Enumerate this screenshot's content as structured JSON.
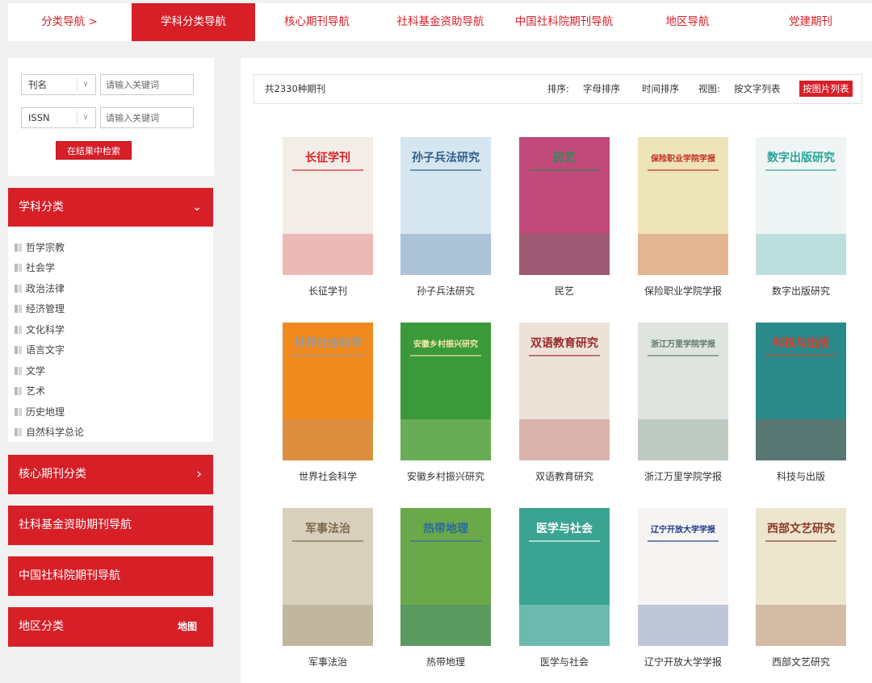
{
  "topnav": {
    "items": [
      {
        "label": "分类导航 >"
      },
      {
        "label": "学科分类导航"
      },
      {
        "label": "核心期刊导航"
      },
      {
        "label": "社科基金资助导航"
      },
      {
        "label": "中国社科院期刊导航"
      },
      {
        "label": "地区导航"
      },
      {
        "label": "党建期刊"
      }
    ],
    "active_index": 1
  },
  "search": {
    "field1": {
      "selected": "刊名",
      "placeholder": "请输入关键词"
    },
    "field2": {
      "selected": "ISSN",
      "placeholder": "请输入关键词"
    },
    "button_label": "在结果中检索"
  },
  "sidebar": {
    "subject": {
      "title": "学科分类",
      "categories": [
        "哲学宗教",
        "社会学",
        "政治法律",
        "经济管理",
        "文化科学",
        "语言文字",
        "文学",
        "艺术",
        "历史地理",
        "自然科学总论"
      ]
    },
    "core": {
      "title": "核心期刊分类"
    },
    "fund": {
      "title": "社科基金资助期刊导航"
    },
    "cass": {
      "title": "中国社科院期刊导航"
    },
    "region": {
      "title": "地区分类",
      "map_label": "地图"
    }
  },
  "toolbar": {
    "count_text": "共2330种期刊",
    "sort_label": "排序:",
    "sort_letter": "字母排序",
    "sort_time": "时间排序",
    "view_label": "视图:",
    "view_text": "按文字列表",
    "view_picture": "按图片列表"
  },
  "journals": [
    {
      "name": "长征学刊",
      "cover_title": "长征学刊",
      "bg": "#f2ede6",
      "accent": "#d71f28"
    },
    {
      "name": "孙子兵法研究",
      "cover_title": "孙子兵法研究",
      "bg": "#d6e6f0",
      "accent": "#2f5d8a"
    },
    {
      "name": "民艺",
      "cover_title": "民艺",
      "bg": "#c24a7a",
      "accent": "#2f8a5a"
    },
    {
      "name": "保险职业学院学报",
      "cover_title": "保险职业学院学报",
      "bg": "#ede4b8",
      "accent": "#c42a20"
    },
    {
      "name": "数字出版研究",
      "cover_title": "数字出版研究",
      "bg": "#eef5f4",
      "accent": "#2aa59a"
    },
    {
      "name": "世界社会科学",
      "cover_title": "世界社会科学",
      "bg": "#f08a1e",
      "accent": "#9a9a9a"
    },
    {
      "name": "安徽乡村振兴研究",
      "cover_title": "安徽乡村振兴研究",
      "bg": "#3a9a3a",
      "accent": "#f4e9a6"
    },
    {
      "name": "双语教育研究",
      "cover_title": "双语教育研究",
      "bg": "#ece2d8",
      "accent": "#9a2a2a"
    },
    {
      "name": "浙江万里学院学报",
      "cover_title": "浙江万里学院学报",
      "bg": "#dfe4df",
      "accent": "#5a7a6a"
    },
    {
      "name": "科技与出版",
      "cover_title": "科技与出版",
      "bg": "#2a8a8a",
      "accent": "#e23a2a"
    },
    {
      "name": "军事法治",
      "cover_title": "军事法治",
      "bg": "#d8cfbd",
      "accent": "#7a6a4a"
    },
    {
      "name": "热带地理",
      "cover_title": "热带地理",
      "bg": "#6aa84a",
      "accent": "#2a6aa0"
    },
    {
      "name": "医学与社会",
      "cover_title": "医学与社会",
      "bg": "#3aa392",
      "accent": "#ffffff"
    },
    {
      "name": "辽宁开放大学学报",
      "cover_title": "辽宁开放大学学报",
      "bg": "#f6f4f2",
      "accent": "#1a3a8a"
    },
    {
      "name": "西部文艺研究",
      "cover_title": "西部文艺研究",
      "bg": "#ede6cf",
      "accent": "#8a3a2a"
    }
  ]
}
